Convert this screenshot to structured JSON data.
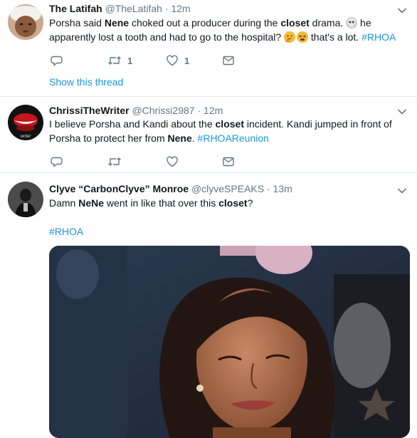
{
  "tweets": [
    {
      "name": "The Latifah",
      "handle": "@TheLatifah",
      "separator": "·",
      "time": "12m",
      "text": {
        "p1": "Porsha said ",
        "b1": "Nene",
        "p2": " choked out a producer during the ",
        "b2": "closet",
        "p3": " drama. ",
        "p4": " he apparently lost a tooth and had to go to the hospital? ",
        "p5": " that's a lot. ",
        "hashtag": "#RHOA"
      },
      "emojis": [
        "skull-emoji",
        "thinking-face-emoji",
        "tired-face-emoji"
      ],
      "retweets": "1",
      "likes": "1",
      "show_thread": "Show this thread"
    },
    {
      "name": "ChrissiTheWriter",
      "handle": "@Chrissi2987",
      "separator": "·",
      "time": "12m",
      "text": {
        "p1": "I believe Porsha and Kandi about the ",
        "b1": "closet",
        "p2": " incident. Kandi jumped in front of Porsha to protect her from ",
        "b2": "Nene",
        "p3": ". ",
        "hashtag": "#RHOAReunion"
      }
    },
    {
      "name": "Clyve “CarbonClyve” Monroe",
      "handle": "@clyveSPEAKS",
      "separator": "·",
      "time": "13m",
      "text": {
        "p1": "Damn ",
        "b1": "NeNe",
        "p2": " went in like that over this ",
        "b2": "closet",
        "p3": "?",
        "hashtag": "#RHOA"
      },
      "media": "gif-image"
    }
  ],
  "icons": {
    "reply": "reply-icon",
    "retweet": "retweet-icon",
    "like": "heart-icon",
    "dm": "direct-message-icon",
    "more": "chevron-down-icon"
  },
  "colors": {
    "link": "#1b95e0",
    "muted": "#657786",
    "divider": "#e6ecf0"
  }
}
